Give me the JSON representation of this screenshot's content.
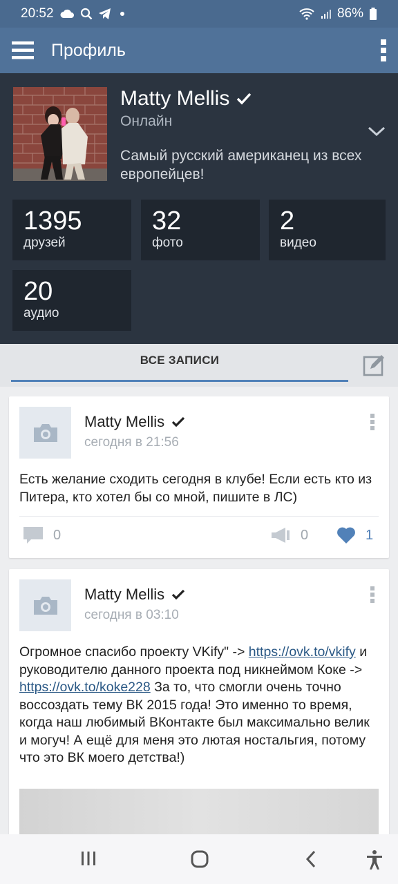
{
  "status_bar": {
    "time": "20:52",
    "battery": "86%",
    "left_icons": [
      "cloud-icon",
      "search-icon",
      "telegram-icon",
      "dot-icon"
    ],
    "right_icons": [
      "wifi-icon",
      "signal-icon",
      "battery-icon"
    ]
  },
  "app_bar": {
    "title": "Профиль",
    "menu_icon": "hamburger-icon",
    "overflow_icon": "more-vertical-icon"
  },
  "profile": {
    "name": "Matty Mellis",
    "verified": true,
    "status": "Онлайн",
    "bio": "Самый русский американец из всех европейцев!",
    "stats": [
      {
        "count": "1395",
        "label": "друзей"
      },
      {
        "count": "32",
        "label": "фото"
      },
      {
        "count": "2",
        "label": "видео"
      },
      {
        "count": "20",
        "label": "аудио"
      }
    ]
  },
  "tabs": {
    "active": "ВСЕ ЗАПИСИ",
    "edit_icon": "edit-icon"
  },
  "posts": [
    {
      "author": "Matty Mellis",
      "date": "сегодня в 21:56",
      "text": "Есть желание сходить сегодня в клубе! Если есть кто из Питера, кто хотел бы со мной, пишите в ЛС)",
      "comments": "0",
      "reposts": "0",
      "likes": "1",
      "liked": true
    },
    {
      "author": "Matty Mellis",
      "date": "сегодня в 03:10",
      "text_parts": {
        "p1": "Огромное спасибо проекту VKify\" -> ",
        "link1": "https://ovk.to/vkify",
        "p2": " и руководителю данного проекта под никнеймом Коке -> ",
        "link2": "https://ovk.to/koke228",
        "p3": " За то, что смогли очень точно воссоздать тему ВК 2015 года! Это именно то время, когда наш любимый ВКонтакте был максимально велик и могуч! А ещё для меня это лютая ностальгия, потому что это ВК моего детства!)"
      }
    }
  ],
  "nav_bar": {
    "icons": [
      "recents-icon",
      "home-icon",
      "back-icon",
      "accessibility-icon"
    ]
  },
  "colors": {
    "header": "#507299",
    "profile_bg": "#2b3440",
    "stat_bg": "#1f262f",
    "accent": "#5181b8",
    "link": "#2a5885"
  }
}
